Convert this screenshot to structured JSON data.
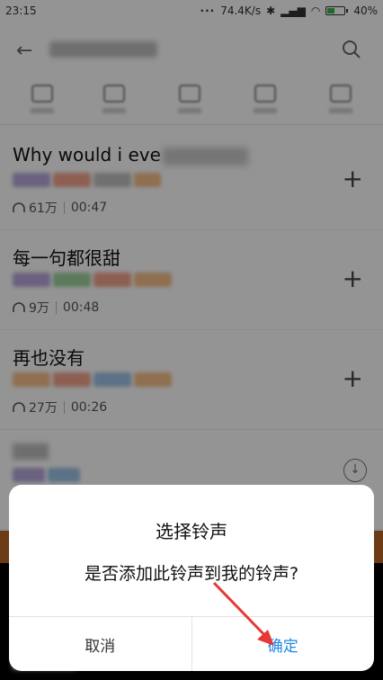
{
  "status_bar": {
    "time": "23:15",
    "speed": "74.4K/s",
    "battery": "40%"
  },
  "list": {
    "items": [
      {
        "title": "Why would i eve",
        "plays": "61万",
        "duration": "00:47",
        "action": "+"
      },
      {
        "title": "每一句都很甜",
        "plays": "9万",
        "duration": "00:48",
        "action": "+"
      },
      {
        "title": "再也没有",
        "plays": "27万",
        "duration": "00:26",
        "action": "+"
      }
    ]
  },
  "dialog": {
    "title": "选择铃声",
    "message": "是否添加此铃声到我的铃声?",
    "cancel_label": "取消",
    "ok_label": "确定"
  },
  "colors": {
    "accent": "#1e88e5",
    "arrow": "#e53935"
  }
}
